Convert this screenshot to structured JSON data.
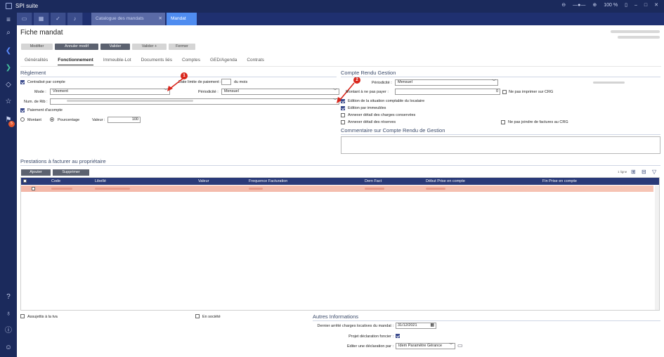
{
  "titlebar": {
    "app_name": "SPI suite",
    "zoom": "100 %"
  },
  "tabs": {
    "catalogue": "Catalogue des mandats",
    "mandat": "Mandat"
  },
  "page": {
    "title": "Fiche mandat"
  },
  "toolbar": {
    "modifier": "Modifier",
    "annuler": "Annuler modif",
    "valider": "Valider",
    "valider_plus": "Valider +",
    "fermer": "Fermer"
  },
  "form_tabs": [
    "Généralités",
    "Fonctionnement",
    "Immeuble-Lot",
    "Documents liés",
    "Comptes",
    "GED/Agenda",
    "Contrats"
  ],
  "reglement": {
    "title": "Règlement",
    "centralise": "Centralisé par compte",
    "limite": "Date limite de paiement :",
    "du_mois": "du mois",
    "mode_label": "Mode :",
    "mode_value": "Virement",
    "periodicite_label": "Périodicité :",
    "periodicite_value": "Mensuel",
    "rib_label": "Num. de Rib :",
    "paiement_acompte": "Paiement d'acompte",
    "montant": "Montant",
    "pourcentage": "Pourcentage",
    "valeur_label": "Valeur :",
    "valeur_value": "100"
  },
  "crg": {
    "title": "Compte Rendu Gestion",
    "periodicite_label": "Périodicité :",
    "periodicite_value": "Mensuel",
    "montant_label": "Montant à ne pas payer :",
    "montant_value": "0",
    "ne_pas_imprimer": "Ne pas imprimer sur CRG",
    "edition_situation": "Edition de la situation comptable du locataire",
    "edition_immeubles": "Edition par immeubles",
    "annexer_charges": "Annexer détail des charges conservées",
    "annexer_reserves": "Annexer détail des réserves",
    "ne_pas_joindre": "Ne pas joindre de factures au CRG",
    "commentaire_title": "Commentaire sur Compte Rendu de Gestion"
  },
  "markers": [
    "1",
    "2"
  ],
  "prestations": {
    "title": "Prestations à facturer au propriétaire",
    "ajouter": "Ajouter",
    "supprimer": "Supprimer",
    "count": "1 ligne",
    "columns": [
      "Code",
      "Libellé",
      "Valeur",
      "Frequence Facturation",
      "Dern Fact",
      "Début Prise en compte",
      "Fin Prise en compte"
    ]
  },
  "footer": {
    "assujettis": "Assujettis à la tva",
    "en_societe": "En société",
    "autres_title": "Autres Informations",
    "dernier_label": "Dernier arrêté charges locatives du mandat :",
    "dernier_value": "31/12/2021",
    "projet_label": "Projet déclaration foncier :",
    "editer_label": "Editer une déclaration par :",
    "editer_value": "Idem Paramètre Gérance"
  },
  "nav_badge": "5",
  "colors": {
    "titlebar": "#1b2a5c",
    "active_tab": "#4f8cf0",
    "grid_header": "#2a3a78",
    "marker": "#d9261c"
  }
}
